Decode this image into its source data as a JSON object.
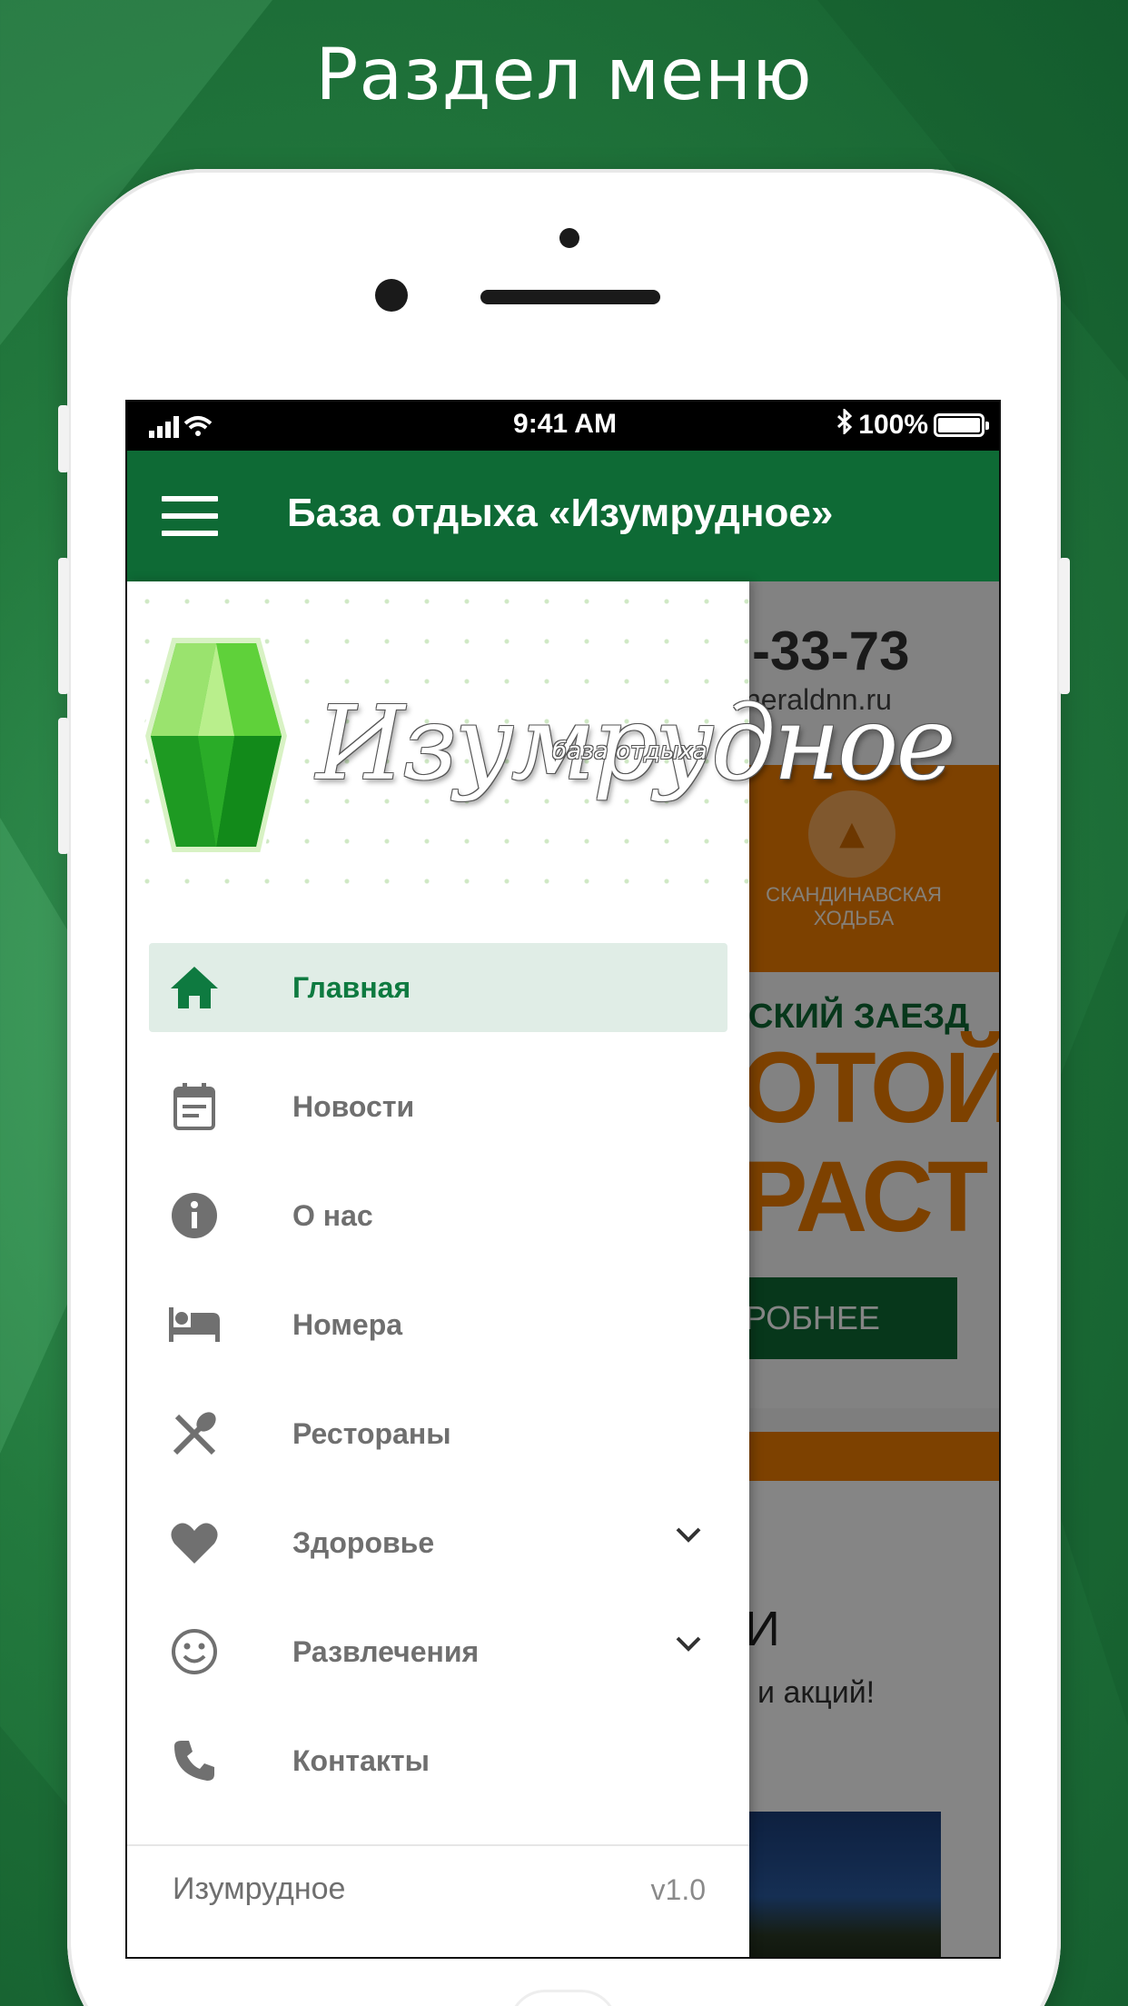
{
  "headline": "Раздел меню",
  "statusbar": {
    "time": "9:41 AM",
    "battery": "100%"
  },
  "appbar": {
    "title": "База отдыха «Изумрудное»"
  },
  "logo": {
    "script": "Изумрудное",
    "subtitle": "база отдыха"
  },
  "menu": {
    "items": [
      {
        "label": "Главная",
        "icon": "home-icon",
        "active": true
      },
      {
        "label": "Новости",
        "icon": "calendar-icon"
      },
      {
        "label": "О нас",
        "icon": "info-icon"
      },
      {
        "label": "Номера",
        "icon": "bed-icon"
      },
      {
        "label": "Рестораны",
        "icon": "restaurant-icon"
      },
      {
        "label": "Здоровье",
        "icon": "heart-icon",
        "expandable": true
      },
      {
        "label": "Развлечения",
        "icon": "smile-icon",
        "expandable": true
      },
      {
        "label": "Контакты",
        "icon": "phone-icon"
      }
    ]
  },
  "footer": {
    "name": "Изумрудное",
    "version": "v1.0"
  },
  "background_page": {
    "phone_fragment": "-33-73",
    "site_fragment": "neraldnn.ru",
    "walk_label_1": "СКАНДИНАВСКАЯ",
    "walk_label_2": "ХОДЬБА",
    "promo_line": "СКИЙ ЗАЕЗД",
    "promo_big_1": "ОТОЙ",
    "promo_big_2": "РАСТ",
    "more_button": "РОБНЕЕ",
    "section_letter": "И",
    "section_sub": "и акций!"
  },
  "colors": {
    "brand_green": "#0e6a35",
    "accent_orange": "#f07d00",
    "active_bg": "#e0ede6"
  }
}
